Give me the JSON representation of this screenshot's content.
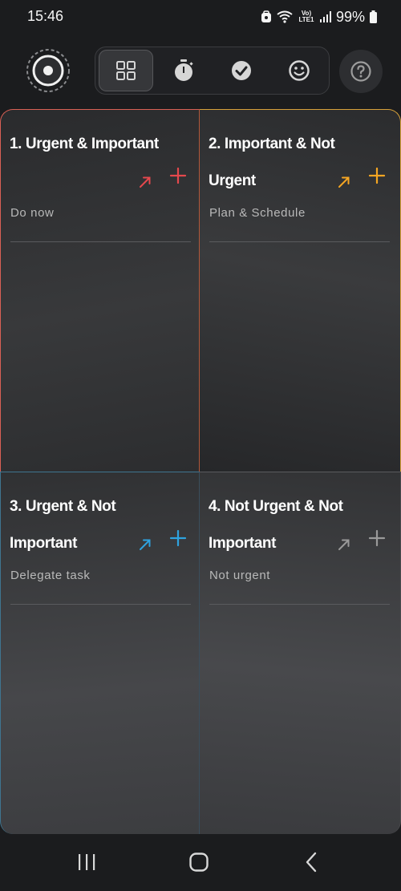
{
  "status": {
    "time": "15:46",
    "network_label": "Vo) LTE1",
    "battery": "99%"
  },
  "toolbar": {
    "tabs": [
      {
        "name": "matrix-tab",
        "icon": "grid-icon",
        "active": true
      },
      {
        "name": "timer-tab",
        "icon": "stopwatch-icon",
        "active": false
      },
      {
        "name": "completed-tab",
        "icon": "check-circle-icon",
        "active": false
      },
      {
        "name": "mood-tab",
        "icon": "smiley-icon",
        "active": false
      }
    ],
    "help_icon": "help-icon"
  },
  "quadrants": [
    {
      "title": "1. Urgent & Important",
      "subtitle": "Do now",
      "color": "#e5484d"
    },
    {
      "title": "2. Important & Not Urgent",
      "subtitle": "Plan & Schedule",
      "color": "#f5a623"
    },
    {
      "title": "3. Urgent & Not Important",
      "subtitle": "Delegate task",
      "color": "#2ea3e0"
    },
    {
      "title": "4. Not Urgent & Not Important",
      "subtitle": "Not urgent",
      "color": "#9a9a9a"
    }
  ],
  "navbar": {
    "icons": [
      "recent-apps-icon",
      "home-icon",
      "back-icon"
    ]
  }
}
